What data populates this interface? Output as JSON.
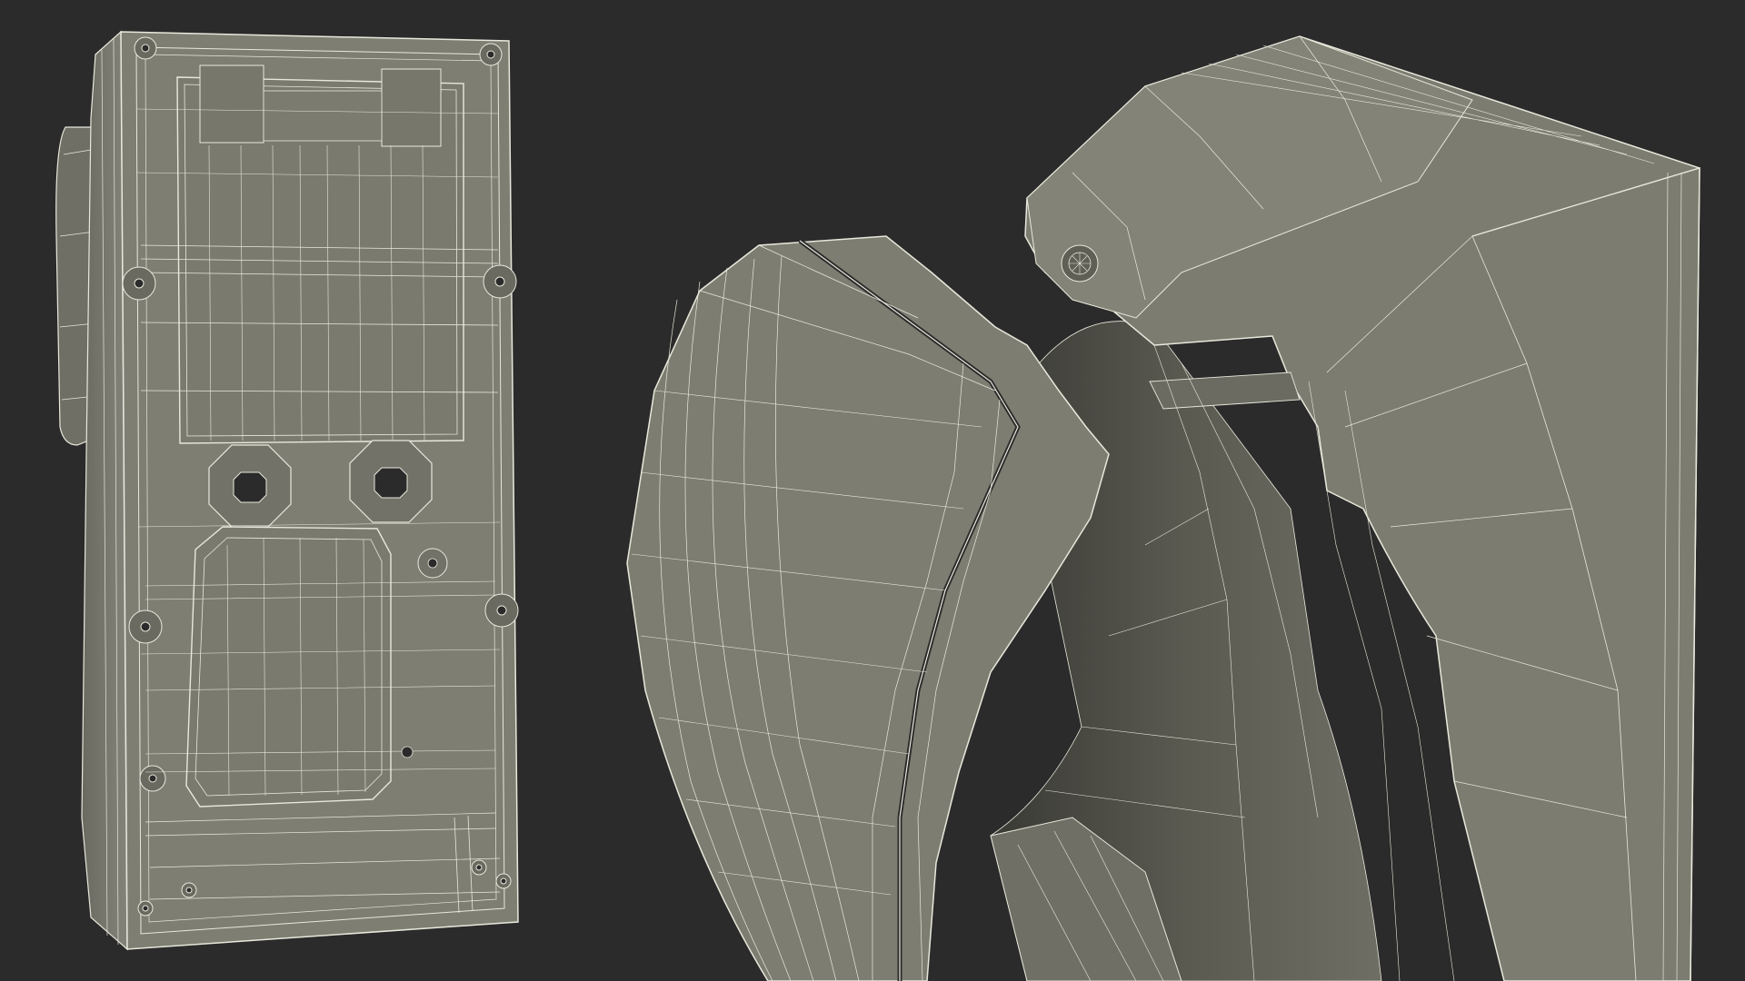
{
  "scene": {
    "background": "#2b2b2b",
    "surface_color": "#7c7c70",
    "surface_shadow": "#5f5f56",
    "surface_dark": "#45453f",
    "wire_color": "#e8e8dc",
    "objects": [
      {
        "name": "multimeter-back-wireframe"
      },
      {
        "name": "clamp-jaw-wireframe"
      }
    ]
  }
}
